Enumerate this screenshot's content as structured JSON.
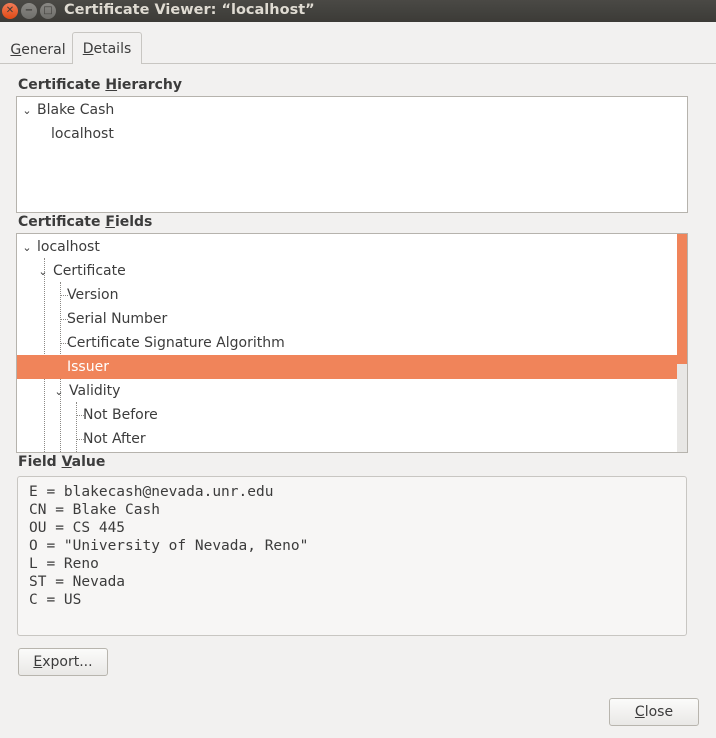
{
  "window": {
    "title": "Certificate Viewer: “localhost”"
  },
  "tabs": [
    {
      "label_first": "G",
      "label_rest": "eneral"
    },
    {
      "label_first": "D",
      "label_rest": "etails"
    }
  ],
  "hierarchy": {
    "heading_pre": "Certificate ",
    "heading_u": "H",
    "heading_post": "ierarchy",
    "items": [
      {
        "label": "Blake Cash",
        "expanded": true
      },
      {
        "label": "localhost"
      }
    ]
  },
  "fields": {
    "heading_pre": "Certificate ",
    "heading_u": "F",
    "heading_post": "ields",
    "items": [
      {
        "label": "localhost",
        "expanded": true
      },
      {
        "label": "Certificate",
        "expanded": true
      },
      {
        "label": "Version"
      },
      {
        "label": "Serial Number"
      },
      {
        "label": "Certificate Signature Algorithm"
      },
      {
        "label": "Issuer",
        "selected": true
      },
      {
        "label": "Validity",
        "expanded": true
      },
      {
        "label": "Not Before"
      },
      {
        "label": "Not After"
      }
    ]
  },
  "field_value": {
    "heading_pre": "Field ",
    "heading_u": "V",
    "heading_post": "alue",
    "text": "E = blakecash@nevada.unr.edu\nCN = Blake Cash\nOU = CS 445\nO = \"University of Nevada, Reno\"\nL = Reno\nST = Nevada\nC = US"
  },
  "buttons": {
    "export_u": "E",
    "export_rest": "xport...",
    "close_u": "C",
    "close_rest": "lose"
  },
  "colors": {
    "accent": "#f0845a",
    "titlebar": "#3c3b37"
  },
  "icons": {
    "expander": "chevron-down-icon",
    "close": "close-icon",
    "minimize": "minimize-icon",
    "maximize": "maximize-icon"
  }
}
